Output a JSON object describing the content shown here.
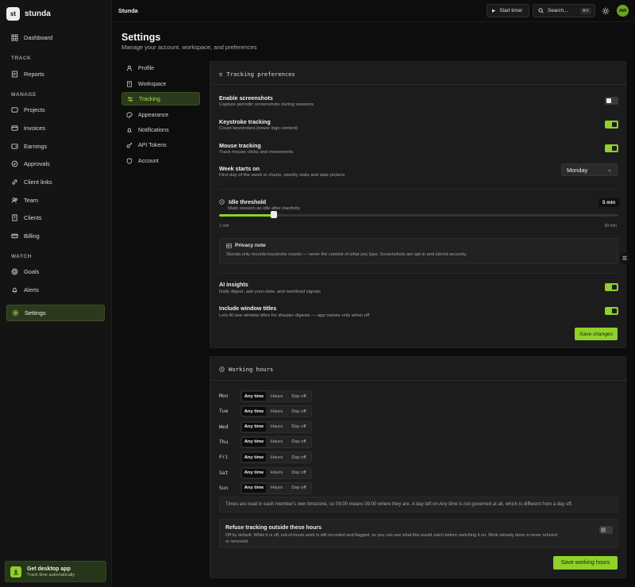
{
  "brand": {
    "logo": "st",
    "name": "stunda"
  },
  "sidebar": {
    "dashboard": "Dashboard",
    "track_section": "TRACK",
    "reports": "Reports",
    "manage_section": "MANAGE",
    "manage": [
      "Projects",
      "Invoices",
      "Earnings",
      "Approvals",
      "Client links",
      "Team",
      "Clients",
      "Billing"
    ],
    "watch_section": "WATCH",
    "goals": "Goals",
    "alerts": "Alerts",
    "settings": "Settings",
    "desktop_title": "Get desktop app",
    "desktop_sub": "Track time automatically"
  },
  "topbar": {
    "breadcrumb": "Stunda",
    "start_timer": "Start timer",
    "search_placeholder": "Search...",
    "search_kbd": "⌘K",
    "avatar": "AW"
  },
  "page": {
    "title": "Settings",
    "subtitle": "Manage your account, workspace, and preferences"
  },
  "settings_nav": [
    "Profile",
    "Workspace",
    "Tracking",
    "Appearance",
    "Notifications",
    "API Tokens",
    "Account"
  ],
  "settings_nav_active": "Tracking",
  "tracking": {
    "header": "Tracking preferences",
    "enable_screenshots": {
      "title": "Enable screenshots",
      "desc": "Capture periodic screenshots during sessions",
      "on": false
    },
    "keystroke": {
      "title": "Keystroke tracking",
      "desc": "Count keystrokes (never logs content)",
      "on": true
    },
    "mouse": {
      "title": "Mouse tracking",
      "desc": "Track mouse clicks and movements",
      "on": true
    },
    "week_start": {
      "title": "Week starts on",
      "desc": "First day of the week in charts, weekly stats and date pickers",
      "value": "Monday"
    },
    "idle": {
      "title": "Idle threshold",
      "desc": "Mark session as idle after inactivity",
      "value": "5 min",
      "min_label": "1 min",
      "max_label": "30 min",
      "min": 1,
      "max": 30,
      "current": 5
    },
    "privacy_title": "Privacy note",
    "privacy_body": "Stunda only records keystroke counts — never the content of what you type. Screenshots are opt-in and stored securely.",
    "ai_insights": {
      "title": "AI insights",
      "desc": "Daily digest, ask-your-data, and workload signals",
      "on": true
    },
    "window_titles": {
      "title": "Include window titles",
      "desc": "Lets AI see window titles for sharper digests — app names only when off",
      "on": true
    },
    "save": "Save changes"
  },
  "working_hours": {
    "header": "Working hours",
    "options": [
      "Any time",
      "Hours",
      "Day off"
    ],
    "days": [
      {
        "day": "Mon",
        "selected": "Any time"
      },
      {
        "day": "Tue",
        "selected": "Any time"
      },
      {
        "day": "Wed",
        "selected": "Any time"
      },
      {
        "day": "Thu",
        "selected": "Any time"
      },
      {
        "day": "Fri",
        "selected": "Any time"
      },
      {
        "day": "Sat",
        "selected": "Any time"
      },
      {
        "day": "Sun",
        "selected": "Any time"
      }
    ],
    "timezone_note": "Times are read in each member's own timezone, so 09:00 means 09:00 where they are. A day left on Any time is not governed at all, which is different from a day off.",
    "refuse_title": "Refuse tracking outside these hours",
    "refuse_desc_1": "Off by default. While it is off, out-of-hours work is still recorded and flagged, so you can see what this would catch before switching it on. Work already done is never refused",
    "refuse_desc_2": "or removed.",
    "refuse_on": false,
    "save": "Save working hours"
  },
  "colors": {
    "accent": "#8fd12a",
    "active_bg": "#2b3a1c",
    "panel": "#1c1c1c",
    "background": "#0d0d0d"
  }
}
